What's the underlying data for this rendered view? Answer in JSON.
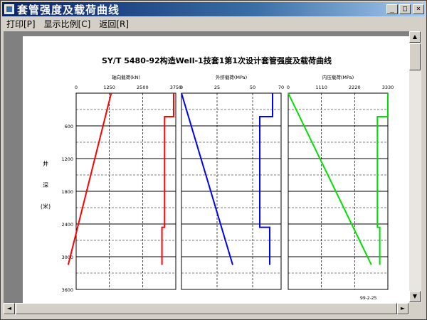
{
  "window": {
    "title": "套管强度及载荷曲线",
    "minimize_glyph": "_",
    "maximize_glyph": "□",
    "close_glyph": "×"
  },
  "menu": [
    {
      "label": "打印[P]"
    },
    {
      "label": "显示比例[C]"
    },
    {
      "label": "返回[R]"
    }
  ],
  "scroll": {
    "up": "▲",
    "down": "▼",
    "left": "◄",
    "right": "►"
  },
  "colors": {
    "axial": "#ff0000",
    "external": "#0000ff",
    "internal": "#00e000",
    "titlebar": "#0a246a"
  },
  "chart_data": {
    "type": "line",
    "title": "SY/T 5480-92构造Well-1技套1第1次设计套管强度及载荷曲线",
    "date": "99-2-25",
    "depth_label_chars": [
      "井",
      "深",
      "(米)"
    ],
    "depth_ticks": [
      "600",
      "1200",
      "1800",
      "2400",
      "3000",
      "3600"
    ],
    "depth_ylim": [
      0,
      3600
    ],
    "panels": [
      {
        "name": "axial",
        "label": "轴向载荷(kN)",
        "xlim": [
          0,
          3750
        ],
        "ticks": [
          {
            "v": 0,
            "t": "0"
          },
          {
            "v": 1250,
            "t": "1250"
          },
          {
            "v": 2500,
            "t": "2500"
          },
          {
            "v": 3750,
            "t": "3750"
          }
        ],
        "load": {
          "depth": [
            0,
            3150
          ],
          "value": [
            1320,
            -300
          ]
        },
        "strength": {
          "depth": [
            0,
            430,
            430,
            2460,
            2460,
            3150
          ],
          "value": [
            3670,
            3670,
            3330,
            3330,
            3230,
            3230
          ]
        }
      },
      {
        "name": "external",
        "label": "外挤载荷(MPa)",
        "xlim": [
          0,
          70
        ],
        "ticks": [
          {
            "v": 0,
            "t": "0"
          },
          {
            "v": 25,
            "t": "25"
          },
          {
            "v": 50,
            "t": "50"
          },
          {
            "v": 70,
            "t": "70"
          }
        ],
        "load": {
          "depth": [
            0,
            3150
          ],
          "value": [
            0,
            36
          ]
        },
        "strength": {
          "depth": [
            0,
            430,
            430,
            2460,
            2460,
            3150
          ],
          "value": [
            64,
            64,
            55,
            55,
            62,
            62
          ]
        }
      },
      {
        "name": "internal",
        "label": "内压载荷(MPa)",
        "xlim": [
          0,
          3330
        ],
        "ticks": [
          {
            "v": 0,
            "t": "0"
          },
          {
            "v": 1110,
            "t": "1110"
          },
          {
            "v": 2220,
            "t": "2220"
          },
          {
            "v": 3330,
            "t": "3330"
          }
        ],
        "load": {
          "depth": [
            0,
            3150
          ],
          "value": [
            0,
            2780
          ]
        },
        "strength": {
          "depth": [
            0,
            430,
            430,
            2460,
            2460,
            3150
          ],
          "value": [
            3330,
            3330,
            2980,
            2980,
            3060,
            3060
          ]
        }
      }
    ]
  }
}
